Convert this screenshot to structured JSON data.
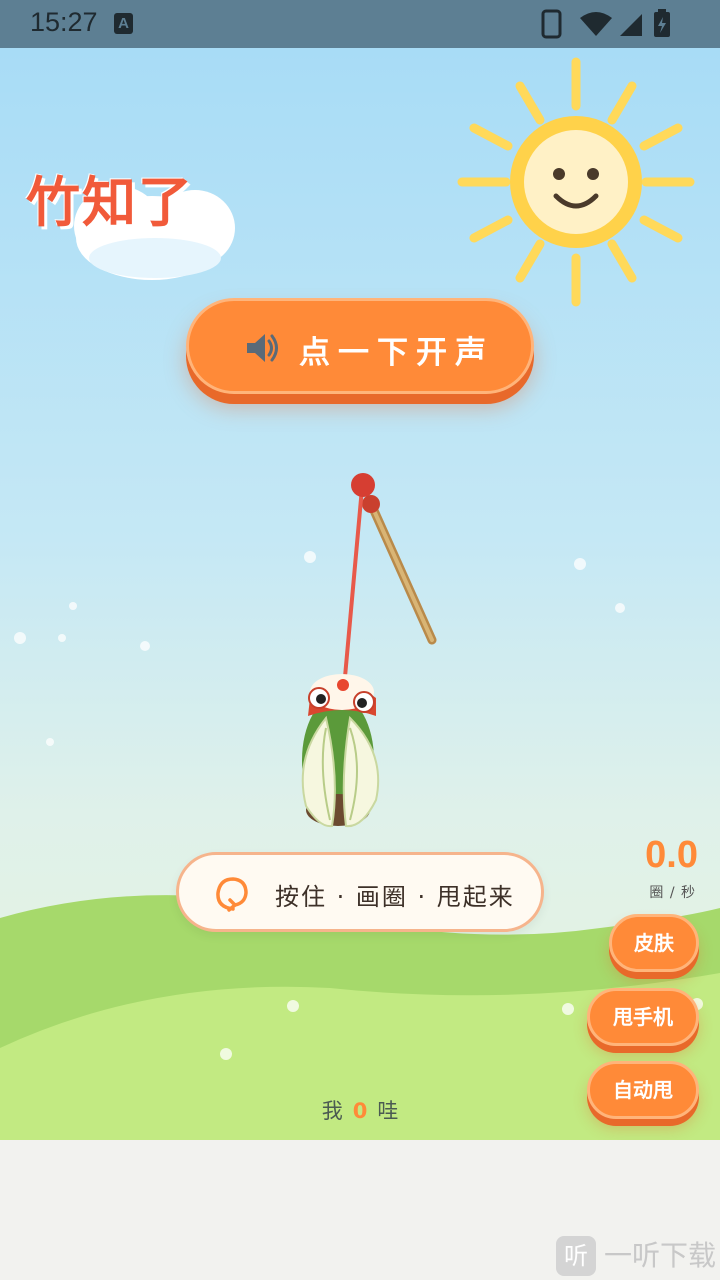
{
  "status_bar": {
    "time": "15:27",
    "a_icon": "A"
  },
  "app": {
    "title": "竹知了"
  },
  "sound_button": {
    "label": "点一下开声",
    "icon": "speaker-icon"
  },
  "hint": {
    "label": "按住 · 画圈 · 甩起来",
    "icon": "circle-gesture-icon"
  },
  "speed": {
    "value": "0.0",
    "unit": "圈 / 秒"
  },
  "side_buttons": {
    "skin": "皮肤",
    "shake_phone": "甩手机",
    "auto_swing": "自动甩"
  },
  "counter": {
    "prefix": "我",
    "count": "0",
    "suffix": "哇"
  },
  "watermark": {
    "icon_char": "听",
    "text": "一听下载"
  },
  "colors": {
    "accent": "#ff8a38",
    "title_red": "#f15a3a",
    "status_bar": "#5d7f93"
  }
}
